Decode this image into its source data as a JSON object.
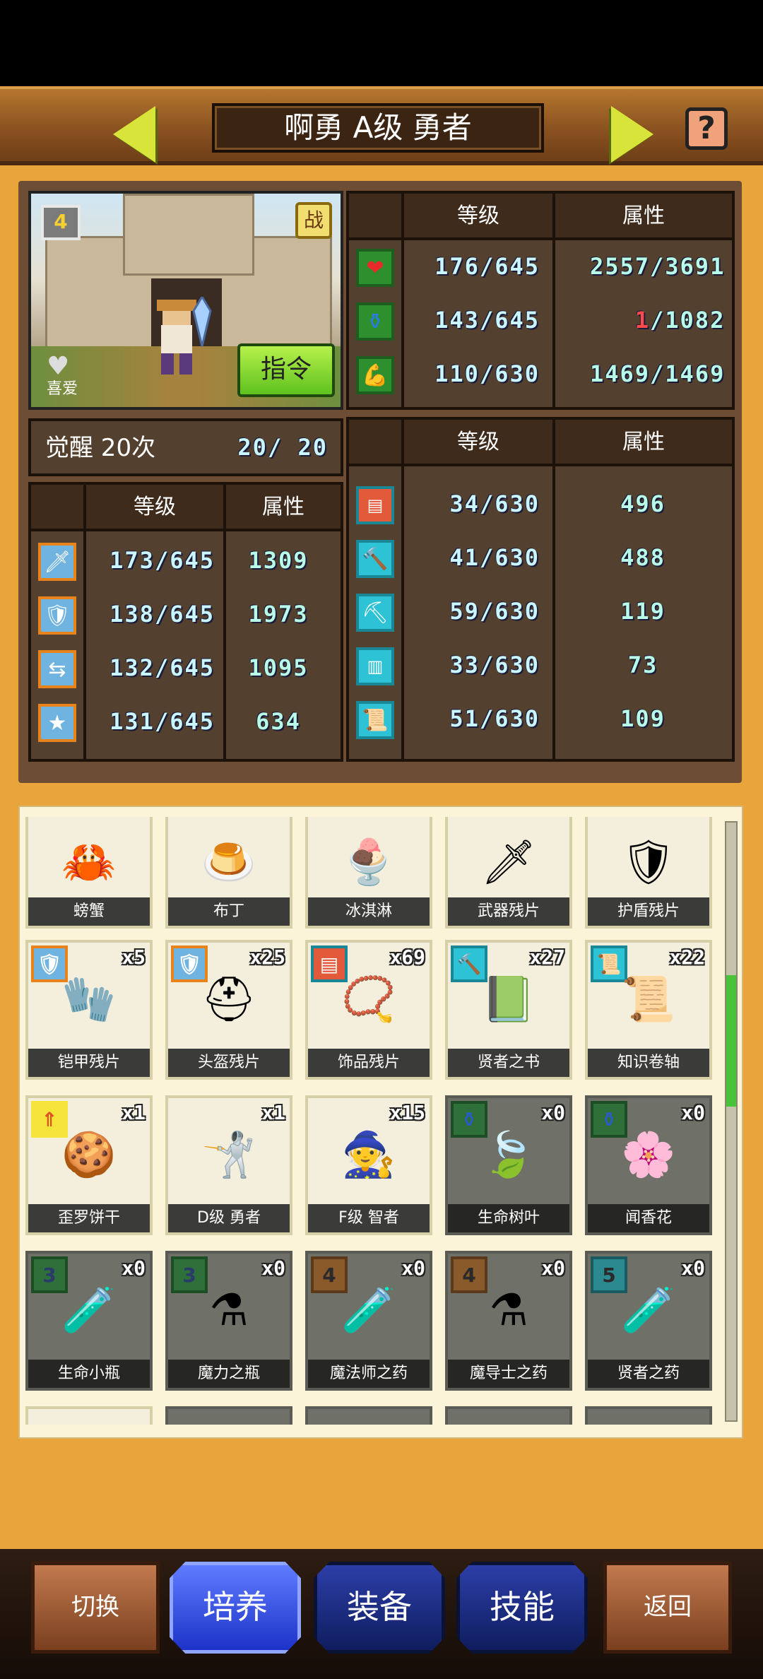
{
  "header": {
    "title": "啊勇 A级 勇者",
    "help_label": "?"
  },
  "portrait": {
    "level_badge": "4",
    "battle_badge": "战",
    "favorite_label": "喜爱",
    "command_button": "指令"
  },
  "vitals": {
    "col_level": "等级",
    "col_attr": "属性",
    "rows": [
      {
        "icon": "heart-icon",
        "level": "176/645",
        "attr_current": "2557",
        "attr_max": "/3691",
        "attr_current_color": "#b8fbe7"
      },
      {
        "icon": "mana-potion-icon",
        "level": "143/645",
        "attr_current": "1",
        "attr_max": "/1082",
        "attr_current_color": "#ff4a4a"
      },
      {
        "icon": "stamina-icon",
        "level": "110/630",
        "attr_current": "1469",
        "attr_max": "/1469",
        "attr_current_color": "#b8fbe7"
      }
    ]
  },
  "awakening": {
    "label": "觉醒 20次",
    "value": "20/ 20"
  },
  "combat_stats": {
    "col_level": "等级",
    "col_attr": "属性",
    "rows": [
      {
        "icon": "sword-icon",
        "level": "173/645",
        "attr": "1309"
      },
      {
        "icon": "shield-icon",
        "level": "138/645",
        "attr": "1973"
      },
      {
        "icon": "dodge-arrows-icon",
        "level": "132/645",
        "attr": "1095"
      },
      {
        "icon": "star-icon",
        "level": "131/645",
        "attr": "634"
      }
    ]
  },
  "skill_stats": {
    "col_level": "等级",
    "col_attr": "属性",
    "rows": [
      {
        "icon": "book-icon",
        "level": "34/630",
        "attr": "496"
      },
      {
        "icon": "hammer-icon",
        "level": "41/630",
        "attr": "488"
      },
      {
        "icon": "shovel-icon",
        "level": "59/630",
        "attr": "119"
      },
      {
        "icon": "chest-icon",
        "level": "33/630",
        "attr": "73"
      },
      {
        "icon": "scroll-icon",
        "level": "51/630",
        "attr": "109"
      }
    ]
  },
  "inventory": {
    "rows": [
      [
        {
          "name": "螃蟹",
          "count": "",
          "art": "🦀",
          "dim": false
        },
        {
          "name": "布丁",
          "count": "",
          "art": "🍮",
          "dim": false
        },
        {
          "name": "冰淇淋",
          "count": "",
          "art": "🍨",
          "dim": false
        },
        {
          "name": "武器残片",
          "count": "",
          "art": "🗡",
          "dim": false
        },
        {
          "name": "护盾残片",
          "count": "",
          "art": "🛡",
          "dim": false
        }
      ],
      [
        {
          "name": "铠甲残片",
          "count": "x5",
          "badge": "shield",
          "art": "🧤",
          "dim": false
        },
        {
          "name": "头盔残片",
          "count": "x25",
          "badge": "shield",
          "art": "⛑",
          "dim": false
        },
        {
          "name": "饰品残片",
          "count": "x69",
          "badge": "book",
          "art": "📿",
          "dim": false
        },
        {
          "name": "贤者之书",
          "count": "x27",
          "badge": "hammer",
          "art": "📗",
          "dim": false
        },
        {
          "name": "知识卷轴",
          "count": "x22",
          "badge": "scroll",
          "art": "📜",
          "dim": false
        }
      ],
      [
        {
          "name": "歪罗饼干",
          "count": "x1",
          "badge": "up",
          "art": "🍪",
          "dim": false
        },
        {
          "name": "D级 勇者",
          "count": "x1",
          "art": "🤺",
          "dim": false
        },
        {
          "name": "F级 智者",
          "count": "x15",
          "art": "🧙",
          "dim": false
        },
        {
          "name": "生命树叶",
          "count": "x0",
          "badge": "potion",
          "art": "🍃",
          "dim": true
        },
        {
          "name": "闻香花",
          "count": "x0",
          "badge": "potion",
          "art": "🌸",
          "dim": true
        }
      ],
      [
        {
          "name": "生命小瓶",
          "count": "x0",
          "badge": "3g",
          "art": "🧪",
          "dim": true
        },
        {
          "name": "魔力之瓶",
          "count": "x0",
          "badge": "3g",
          "art": "⚗",
          "dim": true
        },
        {
          "name": "魔法师之药",
          "count": "x0",
          "badge": "4o",
          "art": "🧪",
          "dim": true
        },
        {
          "name": "魔导士之药",
          "count": "x0",
          "badge": "4o",
          "art": "⚗",
          "dim": true
        },
        {
          "name": "贤者之药",
          "count": "x0",
          "badge": "5c",
          "art": "🧪",
          "dim": true
        }
      ]
    ]
  },
  "nav": {
    "switch": "切换",
    "train": "培养",
    "equip": "装备",
    "skill": "技能",
    "back": "返回"
  },
  "colors": {
    "panel": "#e9a43c",
    "accent_green": "#5ec21e",
    "active_tab": "#1d33c8"
  }
}
